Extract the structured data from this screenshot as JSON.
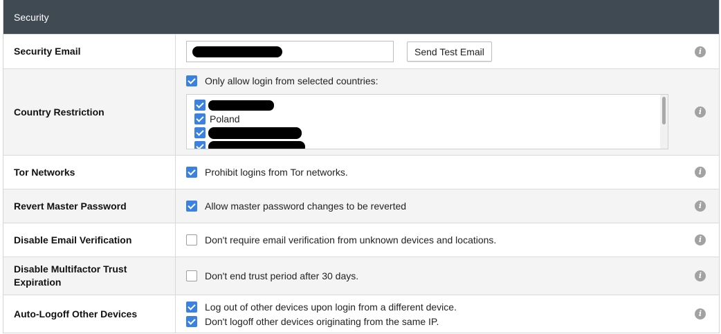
{
  "panel": {
    "title": "Security"
  },
  "rows": {
    "security_email": {
      "label": "Security Email",
      "input_value": "",
      "button_label": "Send Test Email"
    },
    "country_restriction": {
      "label": "Country Restriction",
      "option_label": "Only allow login from selected countries:",
      "option_checked": true,
      "countries": [
        {
          "name": "",
          "checked": true,
          "redacted": true
        },
        {
          "name": "Poland",
          "checked": true,
          "redacted": false
        },
        {
          "name": "",
          "checked": true,
          "redacted": true
        },
        {
          "name": "",
          "checked": true,
          "redacted": true
        }
      ]
    },
    "tor_networks": {
      "label": "Tor Networks",
      "option_label": "Prohibit logins from Tor networks.",
      "option_checked": true
    },
    "revert_master_password": {
      "label": "Revert Master Password",
      "option_label": "Allow master password changes to be reverted",
      "option_checked": true
    },
    "disable_email_verification": {
      "label": "Disable Email Verification",
      "option_label": "Don't require email verification from unknown devices and locations.",
      "option_checked": false
    },
    "disable_multifactor_trust": {
      "label": "Disable Multifactor Trust Expiration",
      "option_label": "Don't end trust period after 30 days.",
      "option_checked": false
    },
    "auto_logoff": {
      "label": "Auto-Logoff Other Devices",
      "option1_label": "Log out of other devices upon login from a different device.",
      "option1_checked": true,
      "option2_label": "Don't logoff other devices originating from the same IP.",
      "option2_checked": true
    }
  },
  "icons": {
    "info": "info-icon",
    "checkbox": "checkbox-icon"
  },
  "colors": {
    "header_bg": "#3f4a52",
    "checkbox_checked": "#3b82e0",
    "info_icon": "#a2a2a2",
    "alt_row_bg": "#f4f4f4"
  }
}
